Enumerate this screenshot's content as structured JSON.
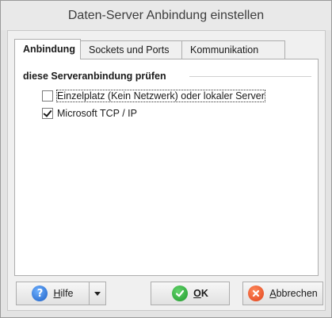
{
  "window": {
    "title": "Daten-Server Anbindung einstellen"
  },
  "tabs": [
    {
      "label": "Anbindung",
      "active": true
    },
    {
      "label": "Sockets und Ports",
      "active": false
    },
    {
      "label": "Kommunikation",
      "active": false
    }
  ],
  "group": {
    "title": "diese Serveranbindung prüfen"
  },
  "options": [
    {
      "label": "Einzelplatz (Kein Netzwerk) oder lokaler Server",
      "checked": false
    },
    {
      "label": "Microsoft TCP / IP",
      "checked": true
    }
  ],
  "buttons": {
    "help_underlined": "H",
    "help_rest": "ilfe",
    "ok_underlined": "O",
    "ok_rest": "K",
    "cancel_underlined": "A",
    "cancel_rest": "bbrechen"
  },
  "icons": {
    "help": "question-mark-icon",
    "ok": "checkmark-icon",
    "cancel": "x-icon",
    "help_dropdown": "caret-down-icon"
  },
  "colors": {
    "help_icon": "#1d5fc4",
    "ok_icon": "#1f9a2c",
    "cancel_icon": "#e0421b"
  }
}
